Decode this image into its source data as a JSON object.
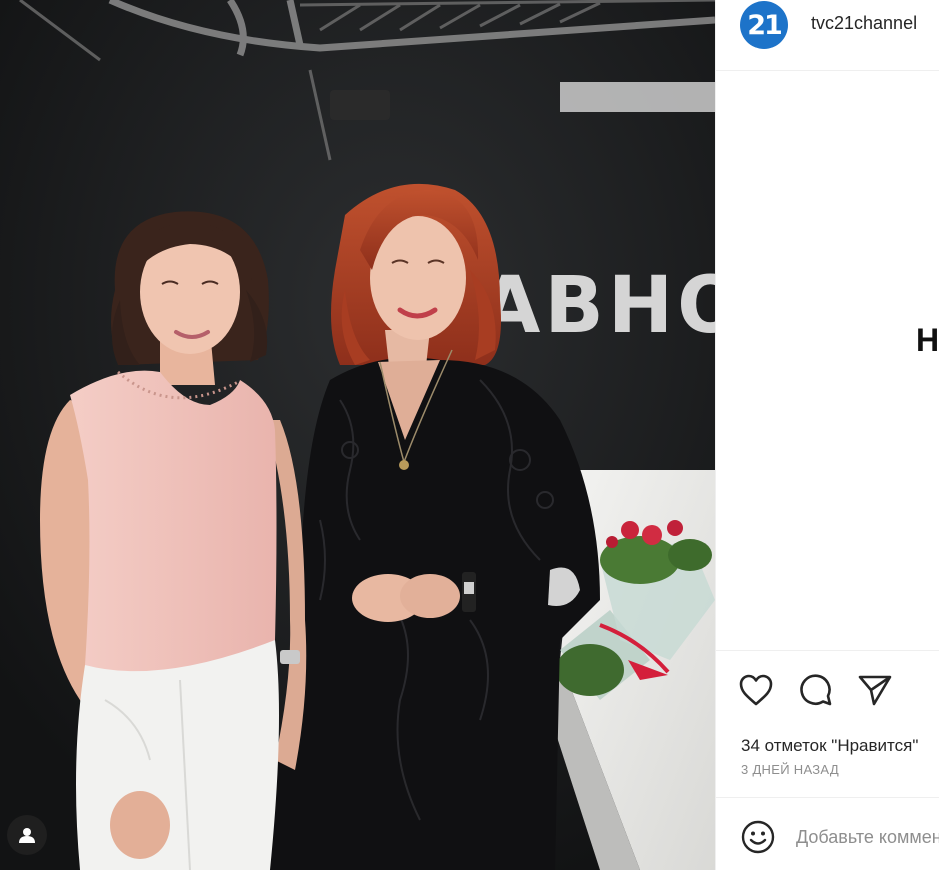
{
  "post": {
    "username": "tvc21channel",
    "avatar_text": "21",
    "caption_fragment": "Н",
    "studio_sign": "АВНО",
    "likes_text": "34 отметок \"Нравится\"",
    "date_text": "3 ДНЕЙ НАЗАД"
  },
  "actions": {
    "like_icon": "heart-icon",
    "comment_icon": "comment-icon",
    "share_icon": "paper-plane-icon",
    "tag_icon": "user-tag-icon",
    "emoji_icon": "smiley-icon"
  },
  "comment": {
    "placeholder": "Добавьте комментарий..."
  },
  "colors": {
    "brand_blue": "#1d73c9",
    "text_dark": "#262626",
    "text_muted": "#8e8e8e",
    "divider": "#efefef",
    "dress_black": "#101012",
    "blouse_pink": "#efc2bc",
    "hair_red": "#b4462a"
  }
}
